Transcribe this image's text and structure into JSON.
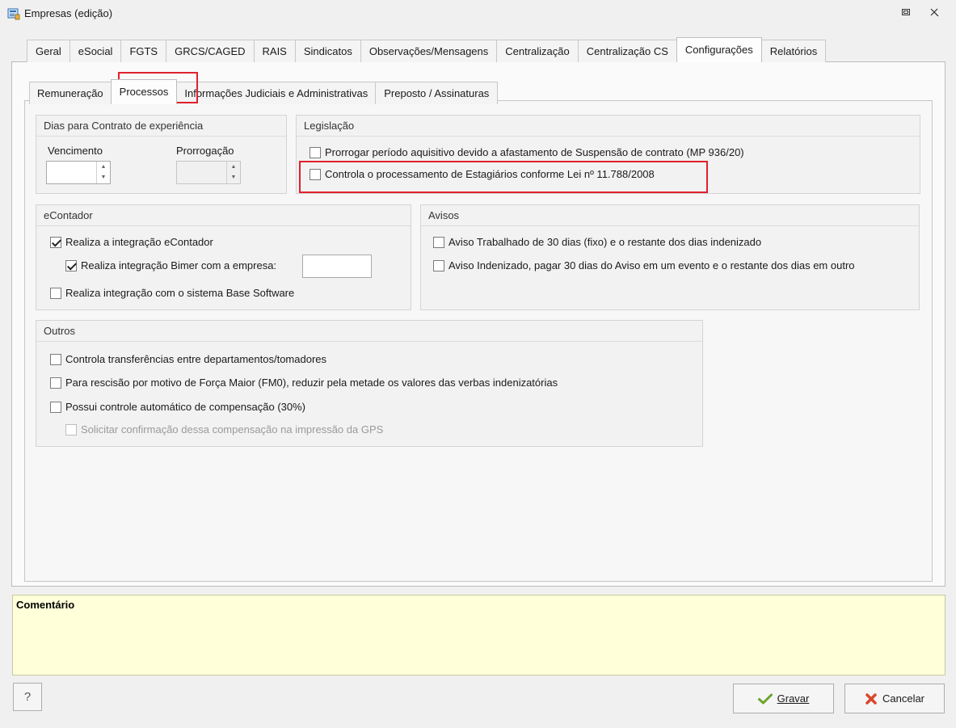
{
  "window": {
    "title": "Empresas (edição)"
  },
  "main_tabs": [
    {
      "label": "Geral"
    },
    {
      "label": "eSocial"
    },
    {
      "label": "FGTS"
    },
    {
      "label": "GRCS/CAGED"
    },
    {
      "label": "RAIS"
    },
    {
      "label": "Sindicatos"
    },
    {
      "label": "Observações/Mensagens"
    },
    {
      "label": "Centralização"
    },
    {
      "label": "Centralização CS"
    },
    {
      "label": "Configurações",
      "active": true
    },
    {
      "label": "Relatórios"
    }
  ],
  "sub_tabs": [
    {
      "label": "Remuneração"
    },
    {
      "label": "Processos",
      "active": true
    },
    {
      "label": "Informações Judiciais e Administrativas"
    },
    {
      "label": "Preposto / Assinaturas"
    }
  ],
  "dias_contrato": {
    "title": "Dias para Contrato de experiência",
    "vencimento_label": "Vencimento",
    "vencimento_value": "",
    "prorrogacao_label": "Prorrogação",
    "prorrogacao_value": ""
  },
  "legislacao": {
    "title": "Legislação",
    "items": [
      {
        "label": "Prorrogar período aquisitivo devido a afastamento de Suspensão de contrato (MP 936/20)",
        "checked": false
      },
      {
        "label": "Controla o processamento de Estagiários conforme Lei nº 11.788/2008",
        "checked": false
      }
    ]
  },
  "econtador": {
    "title": "eContador",
    "items": [
      {
        "label": "Realiza a integração eContador",
        "checked": true
      },
      {
        "label": "Realiza integração Bimer com a empresa:",
        "checked": true
      },
      {
        "label": "Realiza integração com o sistema Base Software",
        "checked": false
      }
    ],
    "bimer_empresa_value": ""
  },
  "avisos": {
    "title": "Avisos",
    "items": [
      {
        "label": "Aviso Trabalhado de 30 dias (fixo) e o restante dos dias indenizado",
        "checked": false
      },
      {
        "label": "Aviso Indenizado, pagar 30 dias do Aviso em um evento e o restante dos dias em outro",
        "checked": false
      }
    ]
  },
  "outros": {
    "title": "Outros",
    "items": [
      {
        "label": "Controla transferências entre departamentos/tomadores",
        "checked": false
      },
      {
        "label": "Para rescisão por motivo de Força Maior (FM0), reduzir pela metade os valores das verbas indenizatórias",
        "checked": false
      },
      {
        "label": "Possui controle automático de compensação (30%)",
        "checked": false
      },
      {
        "label": "Solicitar confirmação dessa compensação na impressão da GPS",
        "checked": false,
        "disabled": true
      }
    ]
  },
  "comment": {
    "title": "Comentário",
    "value": ""
  },
  "footer": {
    "help_label": "?",
    "gravar_label": "Gravar",
    "cancelar_label": "Cancelar"
  },
  "colors": {
    "highlight": "#e0212e",
    "comment_bg": "#ffffd9"
  }
}
